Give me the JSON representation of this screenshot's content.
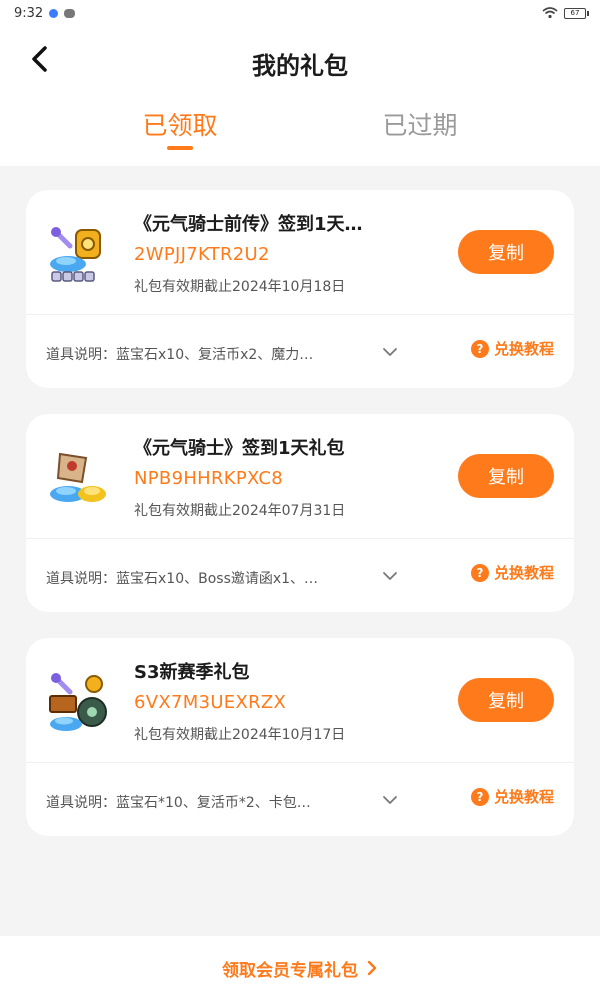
{
  "status_bar": {
    "time": "9:32",
    "battery": "67"
  },
  "header": {
    "title": "我的礼包",
    "tabs": [
      {
        "label": "已领取"
      },
      {
        "label": "已过期"
      }
    ]
  },
  "colors": {
    "accent": "#ff7a1a",
    "background": "#f4f4f4",
    "card": "#ffffff"
  },
  "gifts": [
    {
      "title": "《元气骑士前传》签到1天…",
      "code": "2WPJJ7KTR2U2",
      "expiry": "礼包有效期截止2024年10月18日",
      "copy_label": "复制",
      "items": "道具说明：蓝宝石x10、复活币x2、魔力…",
      "redeem_label": "兑换教程",
      "icon": "gift-bundle-icon"
    },
    {
      "title": "《元气骑士》签到1天礼包",
      "code": "NPB9HHRKPXC8",
      "expiry": "礼包有效期截止2024年07月31日",
      "copy_label": "复制",
      "items": "道具说明：蓝宝石x10、Boss邀请函x1、…",
      "redeem_label": "兑换教程",
      "icon": "gift-bundle-icon"
    },
    {
      "title": "S3新赛季礼包",
      "code": "6VX7M3UEXRZX",
      "expiry": "礼包有效期截止2024年10月17日",
      "copy_label": "复制",
      "items": "道具说明：蓝宝石*10、复活币*2、卡包…",
      "redeem_label": "兑换教程",
      "icon": "gift-bundle-icon"
    }
  ],
  "footer": {
    "label": "领取会员专属礼包"
  }
}
